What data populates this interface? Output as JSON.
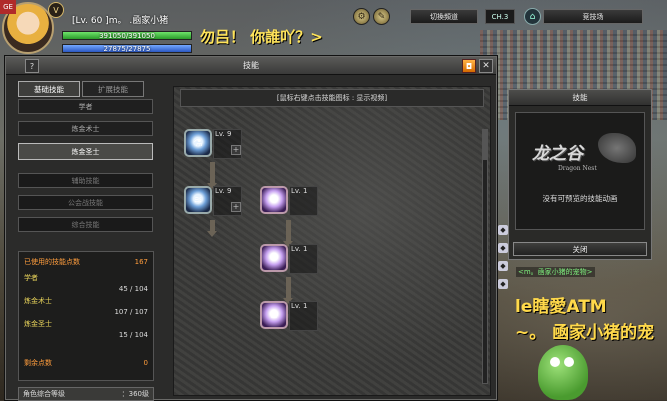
{
  "hud": {
    "corner_badge": "GE",
    "level_badge": "V",
    "char_name": "[Lv. 60 ]m。  .凾家小猪",
    "hp_text": "391050/391050",
    "mp_text": "27875/27875",
    "hp_fraction": 1.0,
    "mp_fraction": 1.0,
    "channel_button": "切換頻道",
    "channel_label": "CH.3",
    "arena_button": "竞技场"
  },
  "chat": {
    "top_message": "勿吕！  你誰吖？>",
    "side_tag": "<m。凾家小猪的宠物>",
    "big_line_1": "le瞎愛ATM",
    "big_line_2": "~。 凾家小猪的宠"
  },
  "window": {
    "title": "技能",
    "help_label": "?",
    "close_label": "✕",
    "tabs": [
      {
        "label": "基础技能",
        "active": true
      },
      {
        "label": "扩展技能",
        "active": false
      }
    ],
    "jobs": [
      {
        "label": "学者",
        "state": "normal"
      },
      {
        "label": "炼金术士",
        "state": "normal"
      },
      {
        "label": "炼金圣士",
        "state": "active"
      },
      {
        "label": "辅助技能",
        "state": "dim"
      },
      {
        "label": "公会战技能",
        "state": "dim"
      },
      {
        "label": "综合技能",
        "state": "dim"
      }
    ],
    "stats": {
      "used_label": "已使用的技能点数",
      "used_value": "167",
      "rows": [
        {
          "label": "学者",
          "value": "45 / 104"
        },
        {
          "label": "炼金术士",
          "value": "107 / 107"
        },
        {
          "label": "炼金圣士",
          "value": "15 / 104"
        }
      ],
      "remain_label": "剩余点数",
      "remain_value": "0"
    },
    "bottom_label": "角色综合等级",
    "bottom_value": "：360级",
    "hint": "[鼠标右键点击技能图标 : 显示视频]",
    "skills": [
      {
        "lv": "Lv. 9"
      },
      {
        "lv": "Lv. 9"
      },
      {
        "lv": "Lv. 1"
      },
      {
        "lv": "Lv. 1"
      },
      {
        "lv": "Lv. 1"
      }
    ],
    "plus": "+"
  },
  "preview": {
    "title": "技能",
    "logo_cn": "龙之谷",
    "logo_en": "Dragon Nest",
    "message": "没有可预览的技能动画",
    "close_button": "关闭"
  }
}
